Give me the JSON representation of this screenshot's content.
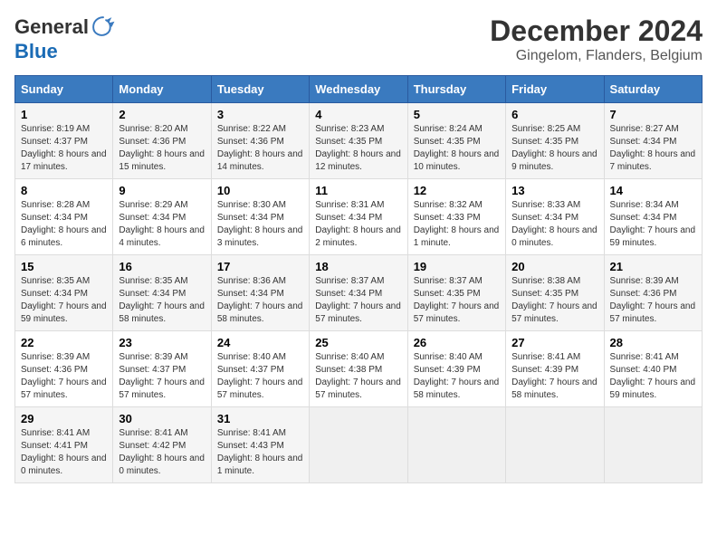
{
  "logo": {
    "general": "General",
    "blue": "Blue"
  },
  "title": "December 2024",
  "location": "Gingelom, Flanders, Belgium",
  "days_of_week": [
    "Sunday",
    "Monday",
    "Tuesday",
    "Wednesday",
    "Thursday",
    "Friday",
    "Saturday"
  ],
  "weeks": [
    [
      {
        "day": "1",
        "sunrise": "8:19 AM",
        "sunset": "4:37 PM",
        "daylight": "8 hours and 17 minutes."
      },
      {
        "day": "2",
        "sunrise": "8:20 AM",
        "sunset": "4:36 PM",
        "daylight": "8 hours and 15 minutes."
      },
      {
        "day": "3",
        "sunrise": "8:22 AM",
        "sunset": "4:36 PM",
        "daylight": "8 hours and 14 minutes."
      },
      {
        "day": "4",
        "sunrise": "8:23 AM",
        "sunset": "4:35 PM",
        "daylight": "8 hours and 12 minutes."
      },
      {
        "day": "5",
        "sunrise": "8:24 AM",
        "sunset": "4:35 PM",
        "daylight": "8 hours and 10 minutes."
      },
      {
        "day": "6",
        "sunrise": "8:25 AM",
        "sunset": "4:35 PM",
        "daylight": "8 hours and 9 minutes."
      },
      {
        "day": "7",
        "sunrise": "8:27 AM",
        "sunset": "4:34 PM",
        "daylight": "8 hours and 7 minutes."
      }
    ],
    [
      {
        "day": "8",
        "sunrise": "8:28 AM",
        "sunset": "4:34 PM",
        "daylight": "8 hours and 6 minutes."
      },
      {
        "day": "9",
        "sunrise": "8:29 AM",
        "sunset": "4:34 PM",
        "daylight": "8 hours and 4 minutes."
      },
      {
        "day": "10",
        "sunrise": "8:30 AM",
        "sunset": "4:34 PM",
        "daylight": "8 hours and 3 minutes."
      },
      {
        "day": "11",
        "sunrise": "8:31 AM",
        "sunset": "4:34 PM",
        "daylight": "8 hours and 2 minutes."
      },
      {
        "day": "12",
        "sunrise": "8:32 AM",
        "sunset": "4:33 PM",
        "daylight": "8 hours and 1 minute."
      },
      {
        "day": "13",
        "sunrise": "8:33 AM",
        "sunset": "4:34 PM",
        "daylight": "8 hours and 0 minutes."
      },
      {
        "day": "14",
        "sunrise": "8:34 AM",
        "sunset": "4:34 PM",
        "daylight": "7 hours and 59 minutes."
      }
    ],
    [
      {
        "day": "15",
        "sunrise": "8:35 AM",
        "sunset": "4:34 PM",
        "daylight": "7 hours and 59 minutes."
      },
      {
        "day": "16",
        "sunrise": "8:35 AM",
        "sunset": "4:34 PM",
        "daylight": "7 hours and 58 minutes."
      },
      {
        "day": "17",
        "sunrise": "8:36 AM",
        "sunset": "4:34 PM",
        "daylight": "7 hours and 58 minutes."
      },
      {
        "day": "18",
        "sunrise": "8:37 AM",
        "sunset": "4:34 PM",
        "daylight": "7 hours and 57 minutes."
      },
      {
        "day": "19",
        "sunrise": "8:37 AM",
        "sunset": "4:35 PM",
        "daylight": "7 hours and 57 minutes."
      },
      {
        "day": "20",
        "sunrise": "8:38 AM",
        "sunset": "4:35 PM",
        "daylight": "7 hours and 57 minutes."
      },
      {
        "day": "21",
        "sunrise": "8:39 AM",
        "sunset": "4:36 PM",
        "daylight": "7 hours and 57 minutes."
      }
    ],
    [
      {
        "day": "22",
        "sunrise": "8:39 AM",
        "sunset": "4:36 PM",
        "daylight": "7 hours and 57 minutes."
      },
      {
        "day": "23",
        "sunrise": "8:39 AM",
        "sunset": "4:37 PM",
        "daylight": "7 hours and 57 minutes."
      },
      {
        "day": "24",
        "sunrise": "8:40 AM",
        "sunset": "4:37 PM",
        "daylight": "7 hours and 57 minutes."
      },
      {
        "day": "25",
        "sunrise": "8:40 AM",
        "sunset": "4:38 PM",
        "daylight": "7 hours and 57 minutes."
      },
      {
        "day": "26",
        "sunrise": "8:40 AM",
        "sunset": "4:39 PM",
        "daylight": "7 hours and 58 minutes."
      },
      {
        "day": "27",
        "sunrise": "8:41 AM",
        "sunset": "4:39 PM",
        "daylight": "7 hours and 58 minutes."
      },
      {
        "day": "28",
        "sunrise": "8:41 AM",
        "sunset": "4:40 PM",
        "daylight": "7 hours and 59 minutes."
      }
    ],
    [
      {
        "day": "29",
        "sunrise": "8:41 AM",
        "sunset": "4:41 PM",
        "daylight": "8 hours and 0 minutes."
      },
      {
        "day": "30",
        "sunrise": "8:41 AM",
        "sunset": "4:42 PM",
        "daylight": "8 hours and 0 minutes."
      },
      {
        "day": "31",
        "sunrise": "8:41 AM",
        "sunset": "4:43 PM",
        "daylight": "8 hours and 1 minute."
      },
      null,
      null,
      null,
      null
    ]
  ],
  "labels": {
    "sunrise": "Sunrise:",
    "sunset": "Sunset:",
    "daylight": "Daylight:"
  }
}
